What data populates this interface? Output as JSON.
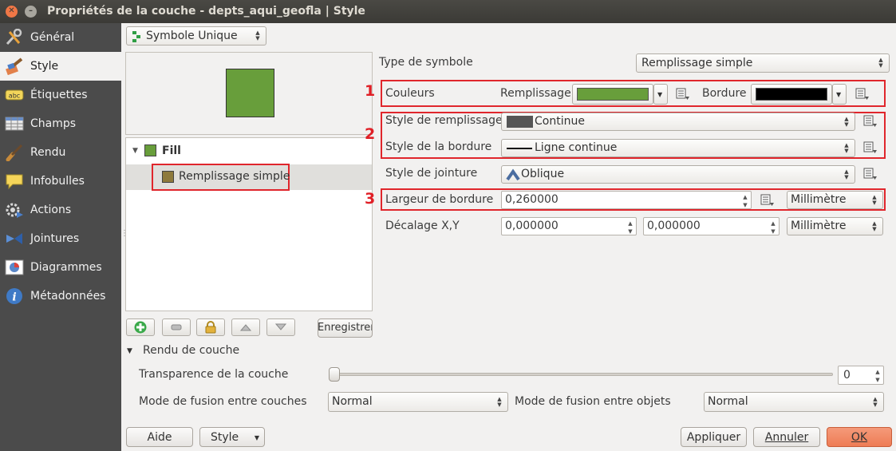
{
  "window": {
    "title": "Propriétés de la couche - depts_aqui_geofla | Style",
    "close_glyph": "✕",
    "min_glyph": "–"
  },
  "sidebar": {
    "items": [
      {
        "label": "Général",
        "icon": "wrench-screwdriver-icon"
      },
      {
        "label": "Style",
        "icon": "paintbrush-icon"
      },
      {
        "label": "Étiquettes",
        "icon": "abc-label-icon"
      },
      {
        "label": "Champs",
        "icon": "table-icon"
      },
      {
        "label": "Rendu",
        "icon": "brush-icon"
      },
      {
        "label": "Infobulles",
        "icon": "speech-bubble-icon"
      },
      {
        "label": "Actions",
        "icon": "gear-play-icon"
      },
      {
        "label": "Jointures",
        "icon": "join-icon"
      },
      {
        "label": "Diagrammes",
        "icon": "pie-chart-icon"
      },
      {
        "label": "Métadonnées",
        "icon": "info-icon"
      }
    ],
    "active_index": 1
  },
  "renderer": {
    "value": "Symbole Unique"
  },
  "tree": {
    "root": "Fill",
    "child": "Remplissage simple"
  },
  "annotations": {
    "n1": "1",
    "n2": "2",
    "n3": "3"
  },
  "props": {
    "type_label": "Type de symbole",
    "type_value": "Remplissage simple",
    "couleurs_label": "Couleurs",
    "remplissage_label": "Remplissage",
    "bordure_label": "Bordure",
    "fill_color": "#689e3b",
    "border_color": "#000000",
    "style_remplissage_label": "Style de remplissage",
    "style_remplissage_value": "Continue",
    "style_bordure_label": "Style de la bordure",
    "style_bordure_value": "Ligne continue",
    "style_jointure_label": "Style de jointure",
    "style_jointure_value": "Oblique",
    "largeur_label": "Largeur de bordure",
    "largeur_value": "0,260000",
    "largeur_unit": "Millimètre",
    "decalage_label": "Décalage X,Y",
    "decalage_x": "0,000000",
    "decalage_y": "0,000000",
    "decalage_unit": "Millimètre"
  },
  "toolbar": {
    "save_label": "Enregistrer"
  },
  "layer_render": {
    "section_title": "Rendu de couche",
    "transparence_label": "Transparence de la couche",
    "transparence_value": "0",
    "transparence_level": 0,
    "fusion_couches_label": "Mode de fusion entre couches",
    "fusion_couches_value": "Normal",
    "fusion_objets_label": "Mode de fusion entre objets",
    "fusion_objets_value": "Normal"
  },
  "footer": {
    "aide": "Aide",
    "style": "Style",
    "appliquer": "Appliquer",
    "annuler": "Annuler",
    "ok": "OK"
  }
}
